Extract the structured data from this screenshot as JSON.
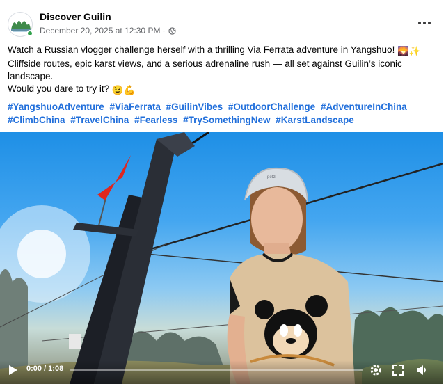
{
  "post": {
    "page_name": "Discover Guilin",
    "date": "December 20, 2025 at 12:30 PM",
    "separator": "·",
    "audience_icon": "globe-icon",
    "body_line1": "Watch a Russian vlogger challenge herself with a thrilling Via Ferrata adventure in Yangshuo!",
    "body_line2": "Cliffside routes, epic karst views, and a serious adrenaline rush — all set against Guilin’s iconic",
    "body_line3": "landscape.",
    "body_line4": "Would you dare to try it?",
    "emojis": {
      "landscape": "🌄",
      "sparkles": "✨",
      "wink": "😉",
      "flex": "💪"
    },
    "hashtags": [
      "#YangshuoAdventure",
      "#ViaFerrata",
      "#GuilinVibes",
      "#OutdoorChallenge",
      "#AdventureInChina",
      "#ClimbChina",
      "#TravelChina",
      "#Fearless",
      "#TrySomethingNew",
      "#KarstLandscape"
    ]
  },
  "video": {
    "time_display": "0:00 / 1:08",
    "progress_fraction": 0.0,
    "helmet_text": "petzl"
  },
  "colors": {
    "hashtag": "#216fdb",
    "meta_text": "#65676b",
    "online": "#31a24c"
  }
}
